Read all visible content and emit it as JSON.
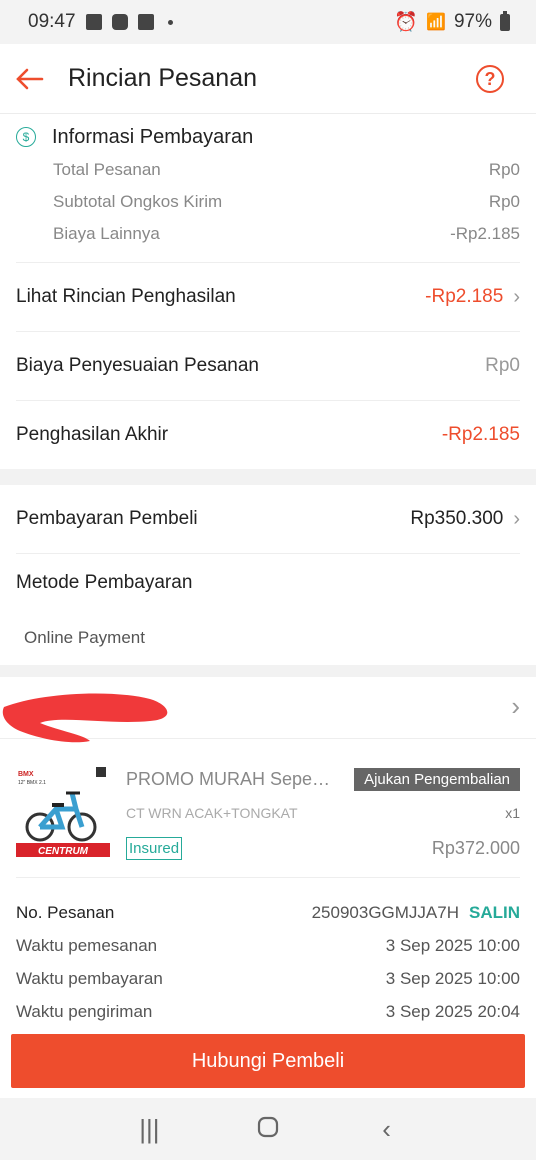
{
  "status_bar": {
    "time": "09:47",
    "battery": "97%"
  },
  "header": {
    "title": "Rincian Pesanan"
  },
  "payment_info": {
    "title": "Informasi Pembayaran",
    "rows": [
      {
        "label": "Total Pesanan",
        "value": "Rp0"
      },
      {
        "label": "Subtotal Ongkos Kirim",
        "value": "Rp0"
      },
      {
        "label": "Biaya Lainnya",
        "value": "-Rp2.185"
      }
    ]
  },
  "earnings": {
    "detail_label": "Lihat Rincian Penghasilan",
    "detail_value": "-Rp2.185",
    "adjust_label": "Biaya Penyesuaian Pesanan",
    "adjust_value": "Rp0",
    "final_label": "Penghasilan Akhir",
    "final_value": "-Rp2.185"
  },
  "buyer_payment": {
    "label": "Pembayaran Pembeli",
    "value": "Rp350.300",
    "method_label": "Metode Pembayaran",
    "method_value": "Online Payment"
  },
  "product": {
    "name": "PROMO MURAH Sepeda ...",
    "return_button": "Ajukan Pengembalian",
    "variant": "CT WRN ACAK+TONGKAT",
    "qty": "x1",
    "insured_label": "Insured",
    "price": "Rp372.000",
    "thumb_brand": "CENTRUM",
    "thumb_size": "12\" BMX 2.1"
  },
  "order": {
    "no_label": "No. Pesanan",
    "no_value": "250903GGMJJA7H",
    "copy_label": "SALIN",
    "times": [
      {
        "label": "Waktu pemesanan",
        "value": "3 Sep 2025 10:00"
      },
      {
        "label": "Waktu pembayaran",
        "value": "3 Sep 2025 10:00"
      },
      {
        "label": "Waktu pengiriman",
        "value": "3 Sep 2025 20:04"
      }
    ]
  },
  "contact_button": "Hubungi Pembeli",
  "colors": {
    "accent": "#ee4d2d",
    "teal": "#26aa99"
  }
}
